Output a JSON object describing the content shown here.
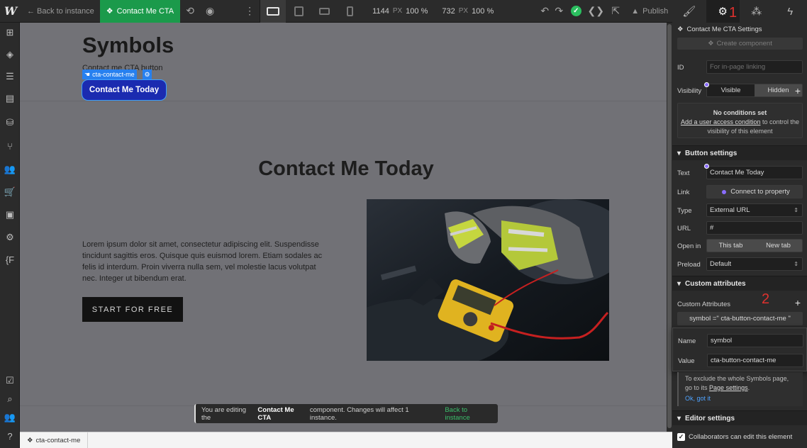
{
  "topbar": {
    "logo": "W",
    "back_label": "← Back to instance",
    "component_name": "Contact Me CTA",
    "width_value": "1144",
    "width_unit": "PX",
    "width_pct": "100 %",
    "height_value": "732",
    "height_unit": "PX",
    "height_pct": "100 %",
    "publish_label": "Publish"
  },
  "annotations": {
    "one": "1",
    "two": "2"
  },
  "canvas": {
    "symbols_title": "Symbols",
    "symbols_subtitle": "Contact me CTA button",
    "selection_label": "cta-contact-me",
    "cta_label": "Contact Me Today",
    "section_title": "Contact Me Today",
    "body_text": "Lorem ipsum dolor sit amet, consectetur adipiscing elit. Suspendisse tincidunt sagittis eros. Quisque quis euismod lorem. Etiam sodales ac felis id interdum. Proin viverra nulla sem, vel molestie lacus volutpat nec. Integer ut bibendum erat.",
    "start_button": "START FOR FREE",
    "toast_prefix": "You are editing the",
    "toast_component": "Contact Me CTA",
    "toast_suffix": "component. Changes will affect 1 instance.",
    "toast_link": "Back to instance"
  },
  "breadcrumb": {
    "item": "cta-contact-me"
  },
  "panel": {
    "settings_title": "Contact Me CTA Settings",
    "create_component": "Create component",
    "id_label": "ID",
    "id_placeholder": "For in-page linking",
    "visibility_label": "Visibility",
    "visible": "Visible",
    "hidden": "Hidden",
    "no_conditions": "No conditions set",
    "conditions_link": "Add a user access condition",
    "conditions_rest": " to control the visibility of this element",
    "button_settings": "Button settings",
    "text_label": "Text",
    "text_value": "Contact Me Today",
    "link_label": "Link",
    "connect_property": "Connect to property",
    "type_label": "Type",
    "type_value": "External URL",
    "url_label": "URL",
    "url_value": "#",
    "open_in_label": "Open in",
    "this_tab": "This tab",
    "new_tab": "New tab",
    "preload_label": "Preload",
    "preload_value": "Default",
    "custom_attrs_head": "Custom attributes",
    "custom_attrs_label": "Custom Attributes",
    "attr_summary": "symbol =\" cta-button-contact-me \"",
    "name_label": "Name",
    "name_value": "symbol",
    "value_label": "Value",
    "value_value": "cta-button-contact-me",
    "exclude_text": "To exclude the whole Symbols page, go to its",
    "page_settings": "Page settings",
    "ok_got_it": "Ok, got it",
    "editor_settings": "Editor settings",
    "collab_label": "Collaborators can edit this element"
  },
  "colors": {
    "accent_green": "#1b9a4b",
    "selection_blue": "#2780ef",
    "cta_blue": "#1b2bb0",
    "annotation_red": "#e0312e",
    "link_green": "#3bbf6b",
    "purple_dot": "#8a6dff"
  }
}
